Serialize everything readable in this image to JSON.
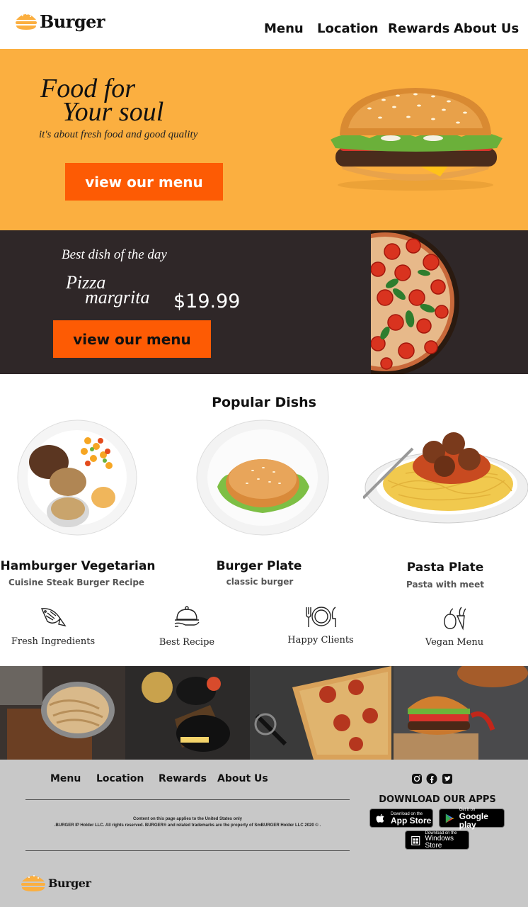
{
  "header": {
    "logo_text": "Burger",
    "nav": [
      "Menu",
      "Location",
      "Rewards",
      "About Us"
    ]
  },
  "hero": {
    "title_line1": "Food for",
    "title_line2": "Your soul",
    "subtitle": "it's about fresh food and good quality",
    "button": "view our menu"
  },
  "dish_of_day": {
    "label": "Best dish of the day",
    "name_line1": "Pizza",
    "name_line2": "margrita",
    "price": "$19.99",
    "button": "view our menu"
  },
  "popular": {
    "title": "Popular Dishs",
    "dishes": [
      {
        "name": "Hamburger Vegetarian",
        "desc": "Cuisine Steak Burger Recipe"
      },
      {
        "name": "Burger Plate",
        "desc": "classic burger"
      },
      {
        "name": "Pasta Plate",
        "desc": "Pasta with meet"
      }
    ]
  },
  "features": [
    {
      "icon": "fish-icon",
      "label": "Fresh Ingredients"
    },
    {
      "icon": "cloche-icon",
      "label": "Best Recipe"
    },
    {
      "icon": "plate-cutlery-icon",
      "label": "Happy Clients"
    },
    {
      "icon": "vegetables-icon",
      "label": "Vegan Menu"
    }
  ],
  "footer": {
    "nav": [
      "Menu",
      "Location",
      "Rewards",
      "About Us"
    ],
    "copy_line1": "Content on this page applies to the United States only",
    "copy_line2": ".BURGER IP Holder LLC. All rights reserved. BURGER® and related trademarks are the property of SmBURGER  Holder LLC 2020 © .",
    "download_title": "DOWNLOAD OUR APPS",
    "stores": [
      {
        "small": "Download on the",
        "big": "App Store"
      },
      {
        "small": "Get it on",
        "big": "Google play"
      },
      {
        "small": "Download on the",
        "big": "Windows Store"
      }
    ],
    "logo_text": "Burger"
  },
  "colors": {
    "accent": "#fbaf40",
    "button": "#fd5b04",
    "dark": "#2f2728",
    "footer_bg": "#c8c8c8"
  }
}
